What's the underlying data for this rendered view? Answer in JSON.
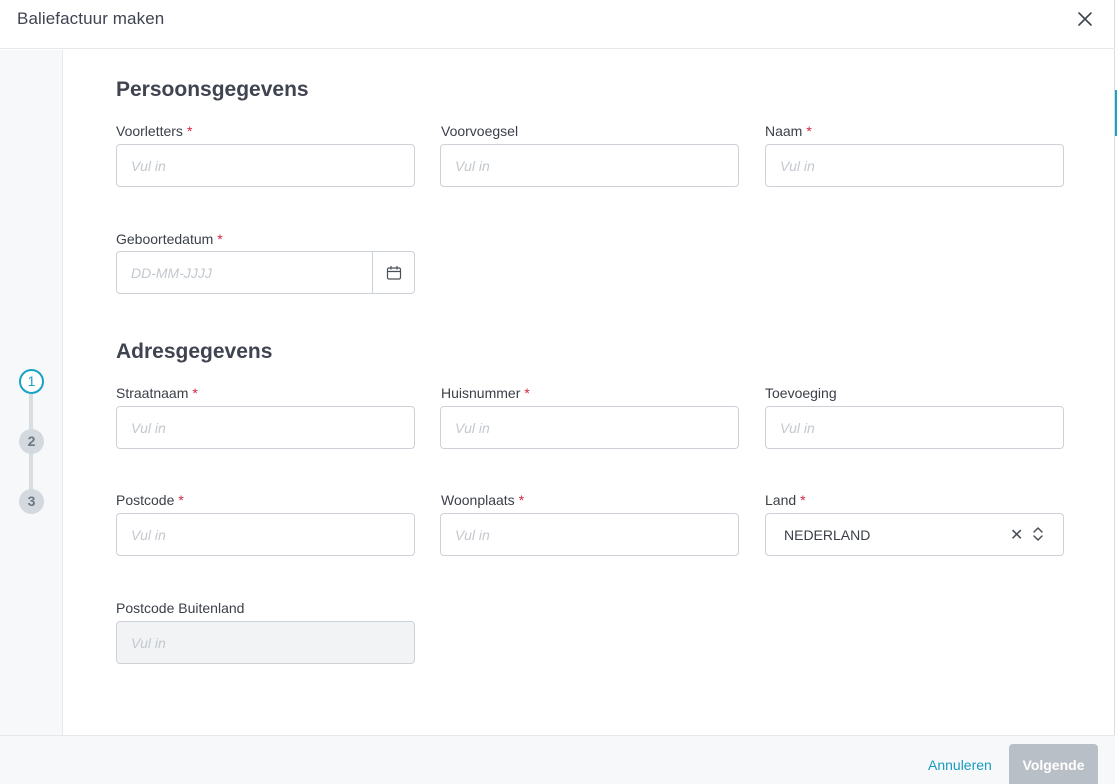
{
  "modal": {
    "title": "Baliefactuur maken"
  },
  "steps": [
    "1",
    "2",
    "3"
  ],
  "sections": {
    "personal": {
      "title": "Persoonsgegevens",
      "voorletters": {
        "label": "Voorletters",
        "placeholder": "Vul in",
        "required": true
      },
      "voorvoegsel": {
        "label": "Voorvoegsel",
        "placeholder": "Vul in",
        "required": false
      },
      "naam": {
        "label": "Naam",
        "placeholder": "Vul in",
        "required": true
      },
      "geboortedatum": {
        "label": "Geboortedatum",
        "placeholder": "DD-MM-JJJJ",
        "required": true
      }
    },
    "address": {
      "title": "Adresgegevens",
      "straatnaam": {
        "label": "Straatnaam",
        "placeholder": "Vul in",
        "required": true
      },
      "huisnummer": {
        "label": "Huisnummer",
        "placeholder": "Vul in",
        "required": true
      },
      "toevoeging": {
        "label": "Toevoeging",
        "placeholder": "Vul in",
        "required": false
      },
      "postcode": {
        "label": "Postcode",
        "placeholder": "Vul in",
        "required": true
      },
      "woonplaats": {
        "label": "Woonplaats",
        "placeholder": "Vul in",
        "required": true
      },
      "land": {
        "label": "Land",
        "value": "NEDERLAND",
        "required": true
      },
      "postcode_buitenland": {
        "label": "Postcode Buitenland",
        "placeholder": "Vul in",
        "required": false
      }
    }
  },
  "required_marker": "*",
  "footer": {
    "cancel_label": "Annuleren",
    "next_label": "Volgende"
  },
  "icons": {
    "close": "close-icon",
    "calendar": "calendar-icon",
    "clear": "clear-icon",
    "updown": "chevron-updown-icon"
  },
  "colors": {
    "accent": "#17a2c6",
    "required": "#d9233d",
    "disabled_button": "#b9bfc6"
  }
}
